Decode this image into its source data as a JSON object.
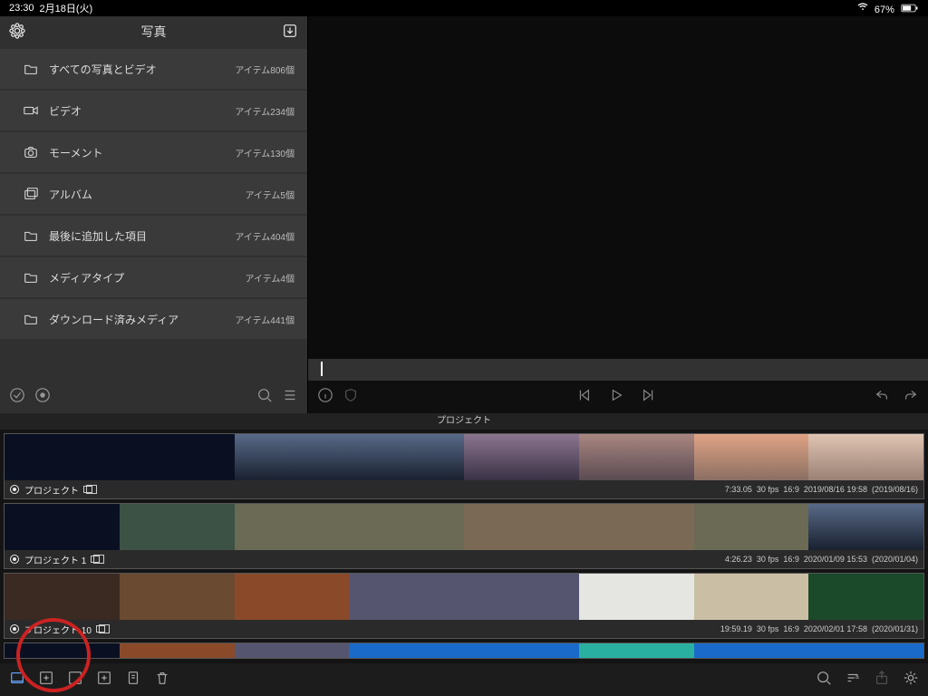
{
  "status": {
    "time": "23:30",
    "date": "2月18日(火)",
    "battery": "67%"
  },
  "leftPanel": {
    "title": "写真",
    "items": [
      {
        "label": "すべての写真とビデオ",
        "count": "アイテム806個",
        "icon": "folder"
      },
      {
        "label": "ビデオ",
        "count": "アイテム234個",
        "icon": "video"
      },
      {
        "label": "モーメント",
        "count": "アイテム130個",
        "icon": "camera"
      },
      {
        "label": "アルバム",
        "count": "アイテム5個",
        "icon": "albums"
      },
      {
        "label": "最後に追加した項目",
        "count": "アイテム404個",
        "icon": "folder"
      },
      {
        "label": "メディアタイプ",
        "count": "アイテム4個",
        "icon": "folder"
      },
      {
        "label": "ダウンロード済みメディア",
        "count": "アイテム441個",
        "icon": "folder"
      }
    ]
  },
  "projectsHeader": "プロジェクト",
  "projects": [
    {
      "name": "プロジェクト",
      "duration": "7:33.05",
      "fps": "30 fps",
      "aspect": "16:9",
      "ts": "2019/08/16 19:58",
      "date": "(2019/08/16)",
      "thumbs": [
        "g-dark",
        "g-dark",
        "g-dusk1",
        "g-dusk1",
        "g-dusk2",
        "g-pdawn",
        "g-sun1",
        "g-sun2"
      ]
    },
    {
      "name": "プロジェクト 1",
      "duration": "4:26.23",
      "fps": "30 fps",
      "aspect": "16:9",
      "ts": "2020/01/09 15:53",
      "date": "(2020/01/04)",
      "thumbs": [
        "g-dark",
        "g-stat1",
        "g-stat2",
        "g-stat2",
        "g-stat3",
        "g-stat3",
        "g-stat2",
        "g-dusk1"
      ]
    },
    {
      "name": "プロジェクト 10",
      "duration": "19:59.19",
      "fps": "30 fps",
      "aspect": "16:9",
      "ts": "2020/02/01 17:58",
      "date": "(2020/01/31)",
      "thumbs": [
        "g-store1",
        "g-store2",
        "g-col1",
        "g-store3",
        "g-store3",
        "g-bk",
        "g-cart",
        "g-grn"
      ]
    }
  ],
  "extraThumbs": [
    "g-dark",
    "g-col1",
    "g-store3",
    "g-col2",
    "g-col2",
    "g-col3",
    "g-col2",
    "g-col2"
  ]
}
